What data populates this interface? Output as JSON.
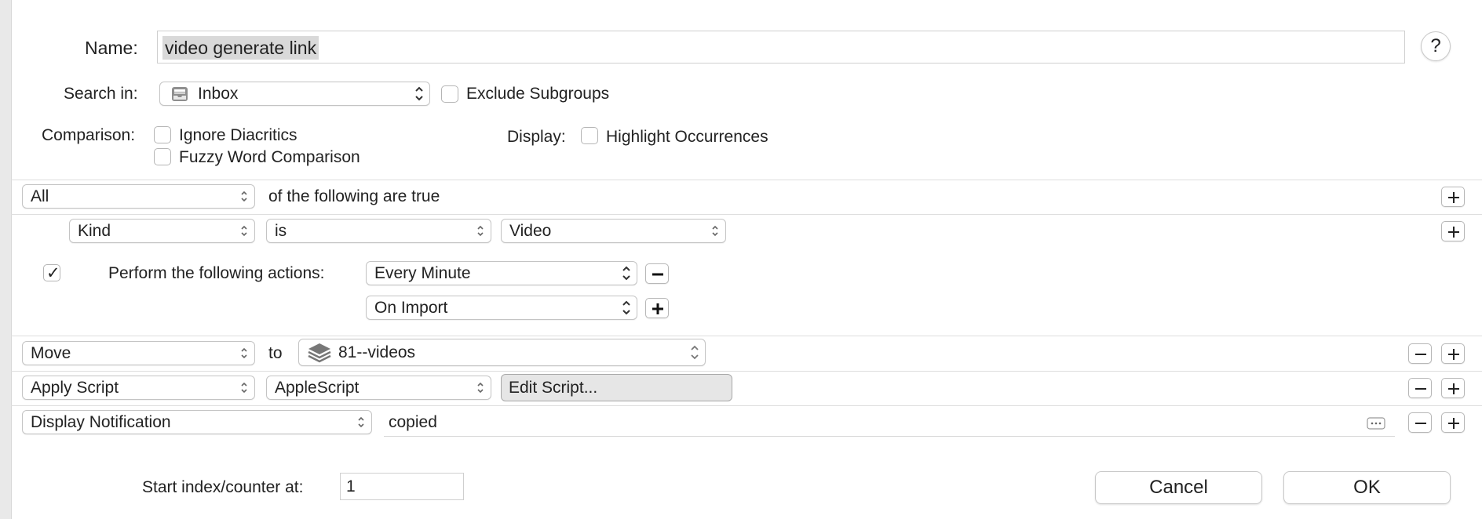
{
  "name": {
    "label": "Name:",
    "value": "video generate link"
  },
  "help": {
    "symbol": "?"
  },
  "search_in": {
    "label": "Search in:",
    "value": "Inbox",
    "icon": "inbox-tray-icon"
  },
  "exclude_subgroups": {
    "label": "Exclude Subgroups",
    "checked": false
  },
  "comparison": {
    "label": "Comparison:",
    "ignore_diacritics": {
      "label": "Ignore Diacritics",
      "checked": false
    },
    "fuzzy_word": {
      "label": "Fuzzy Word Comparison",
      "checked": false
    }
  },
  "display": {
    "label": "Display:",
    "highlight": {
      "label": "Highlight Occurrences",
      "checked": false
    }
  },
  "conditions": {
    "match_value": "All",
    "match_suffix": "of the following are true",
    "rule": {
      "field": "Kind",
      "operator": "is",
      "value": "Video"
    }
  },
  "perform": {
    "checked": true,
    "label": "Perform the following actions:",
    "triggers": [
      "Every Minute",
      "On Import"
    ]
  },
  "actions": {
    "move": {
      "action": "Move",
      "to_label": "to",
      "destination": "81--videos",
      "icon": "database-layers-icon"
    },
    "script": {
      "action": "Apply Script",
      "type": "AppleScript",
      "edit_label": "Edit Script..."
    },
    "notify": {
      "action": "Display Notification",
      "text": "copied"
    }
  },
  "counter": {
    "label": "Start index/counter at:",
    "value": "1"
  },
  "buttons": {
    "cancel": "Cancel",
    "ok": "OK"
  }
}
